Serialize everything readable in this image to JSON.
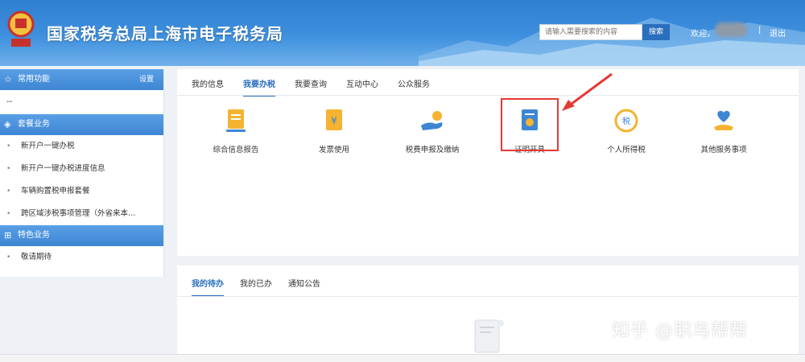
{
  "header": {
    "title": "国家税务总局上海市电子税务局",
    "search_placeholder": "请输入需要搜索的内容",
    "search_label": "搜索",
    "welcome": "欢迎，",
    "separator": "|",
    "logout": "退出"
  },
  "sidebar": {
    "common_title": "常用功能",
    "settings_label": "设置",
    "common_placeholder": "--",
    "package_title": "套餐业务",
    "package_items": [
      "新开户一键办税",
      "新开户一键办税进度信息",
      "车辆购置税申报套餐",
      "跨区域涉税事项管理（外省来本…"
    ],
    "special_title": "特色业务",
    "special_items": [
      "敬请期待"
    ]
  },
  "main": {
    "tabs": [
      "我的信息",
      "我要办税",
      "我要查询",
      "互动中心",
      "公众服务"
    ],
    "services": [
      "综合信息报告",
      "发票使用",
      "税费申报及缴纳",
      "证明开具",
      "个人所得税",
      "其他服务事项"
    ]
  },
  "todo": {
    "tabs": [
      "我的待办",
      "我的已办",
      "通知公告"
    ]
  },
  "watermark": "知乎 @职鸟帮帮",
  "colors": {
    "brand": "#2a6fbd",
    "header_top": "#2f7fd0",
    "highlight": "#e53935"
  }
}
